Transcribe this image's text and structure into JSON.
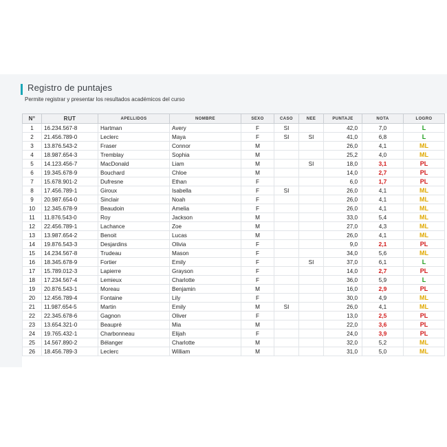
{
  "header": {
    "title": "Registro de puntajes",
    "subtitle": "Permite registrar y presentar los resultados académicos del curso"
  },
  "colors": {
    "accent": "#1aa6b7",
    "low_score": "#d11a1a",
    "L": "#1a9d1a",
    "ML": "#e0a800",
    "PL": "#d11a1a"
  },
  "table": {
    "columns": [
      "N°",
      "RUT",
      "APELLIDOS",
      "NOMBRE",
      "SEXO",
      "CASO",
      "NEE",
      "PUNTAJE",
      "NOTA",
      "LOGRO"
    ],
    "rows": [
      [
        "1",
        "16.234.567-8",
        "Hartman",
        "Avery",
        "F",
        "SI",
        "",
        "42,0",
        "7,0",
        "L"
      ],
      [
        "2",
        "21.456.789-0",
        "Leclerc",
        "Maya",
        "F",
        "SI",
        "SI",
        "41,0",
        "6,8",
        "L"
      ],
      [
        "3",
        "13.876.543-2",
        "Fraser",
        "Connor",
        "M",
        "",
        "",
        "26,0",
        "4,1",
        "ML"
      ],
      [
        "4",
        "18.987.654-3",
        "Tremblay",
        "Sophia",
        "M",
        "",
        "",
        "25,2",
        "4,0",
        "ML"
      ],
      [
        "5",
        "14.123.456-7",
        "MacDonald",
        "Liam",
        "M",
        "",
        "SI",
        "18,0",
        "3,1",
        "PL"
      ],
      [
        "6",
        "19.345.678-9",
        "Bouchard",
        "Chloe",
        "M",
        "",
        "",
        "14,0",
        "2,7",
        "PL"
      ],
      [
        "7",
        "15.678.901-2",
        "Dufresne",
        "Ethan",
        "F",
        "",
        "",
        "6,0",
        "1,7",
        "PL"
      ],
      [
        "8",
        "17.456.789-1",
        "Giroux",
        "Isabella",
        "F",
        "SI",
        "",
        "26,0",
        "4,1",
        "ML"
      ],
      [
        "9",
        "20.987.654-0",
        "Sinclair",
        "Noah",
        "F",
        "",
        "",
        "26,0",
        "4,1",
        "ML"
      ],
      [
        "10",
        "12.345.678-9",
        "Beaudoin",
        "Amelia",
        "F",
        "",
        "",
        "26,0",
        "4,1",
        "ML"
      ],
      [
        "11",
        "11.876.543-0",
        "Roy",
        "Jackson",
        "M",
        "",
        "",
        "33,0",
        "5,4",
        "ML"
      ],
      [
        "12",
        "22.456.789-1",
        "Lachance",
        "Zoe",
        "M",
        "",
        "",
        "27,0",
        "4,3",
        "ML"
      ],
      [
        "13",
        "13.987.654-2",
        "Benoit",
        "Lucas",
        "M",
        "",
        "",
        "26,0",
        "4,1",
        "ML"
      ],
      [
        "14",
        "19.876.543-3",
        "Desjardins",
        "Olivia",
        "F",
        "",
        "",
        "9,0",
        "2,1",
        "PL"
      ],
      [
        "15",
        "14.234.567-8",
        "Trudeau",
        "Mason",
        "F",
        "",
        "",
        "34,0",
        "5,6",
        "ML"
      ],
      [
        "16",
        "18.345.678-9",
        "Fortier",
        "Emily",
        "F",
        "",
        "SI",
        "37,0",
        "6,1",
        "L"
      ],
      [
        "17",
        "15.789.012-3",
        "Lapierre",
        "Grayson",
        "F",
        "",
        "",
        "14,0",
        "2,7",
        "PL"
      ],
      [
        "18",
        "17.234.567-4",
        "Lemieux",
        "Charlotte",
        "F",
        "",
        "",
        "36,0",
        "5,9",
        "L"
      ],
      [
        "19",
        "20.876.543-1",
        "Moreau",
        "Benjamin",
        "M",
        "",
        "",
        "16,0",
        "2,9",
        "PL"
      ],
      [
        "20",
        "12.456.789-4",
        "Fontaine",
        "Lily",
        "F",
        "",
        "",
        "30,0",
        "4,9",
        "ML"
      ],
      [
        "21",
        "11.987.654-5",
        "Martin",
        "Emily",
        "M",
        "SI",
        "",
        "26,0",
        "4,1",
        "ML"
      ],
      [
        "22",
        "22.345.678-6",
        "Gagnon",
        "Oliver",
        "F",
        "",
        "",
        "13,0",
        "2,5",
        "PL"
      ],
      [
        "23",
        "13.654.321-0",
        "Beaupré",
        "Mia",
        "M",
        "",
        "",
        "22,0",
        "3,6",
        "PL"
      ],
      [
        "24",
        "19.765.432-1",
        "Charbonneau",
        "Elijah",
        "F",
        "",
        "",
        "24,0",
        "3,9",
        "PL"
      ],
      [
        "25",
        "14.567.890-2",
        "Bélanger",
        "Charlotte",
        "M",
        "",
        "",
        "32,0",
        "5,2",
        "ML"
      ],
      [
        "26",
        "18.456.789-3",
        "Leclerc",
        "William",
        "M",
        "",
        "",
        "31,0",
        "5,0",
        "ML"
      ]
    ]
  }
}
